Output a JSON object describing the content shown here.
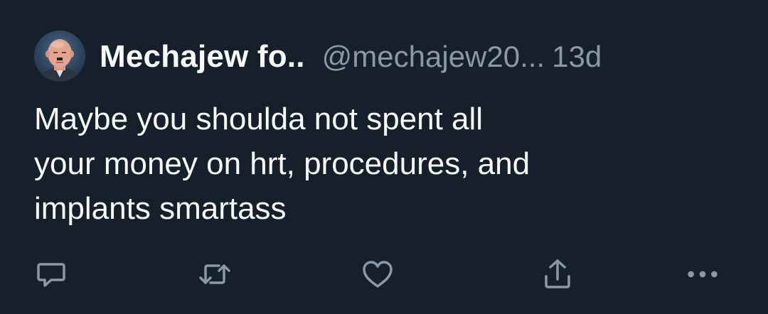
{
  "tweet": {
    "display_name": "Mechajew fo..",
    "handle": "@mechajew20...",
    "time": "13d",
    "text_lines": [
      "Maybe you shoulda not spent all",
      "your money on hrt, procedures, and",
      "implants smartass"
    ]
  },
  "actions": {
    "icons": [
      "reply-icon",
      "retweet-icon",
      "like-icon",
      "share-icon",
      "more-icon"
    ]
  },
  "colors": {
    "background": "#15202b",
    "text": "#f7f9f9",
    "muted": "#8b98a5",
    "icon": "#8b98a5"
  }
}
